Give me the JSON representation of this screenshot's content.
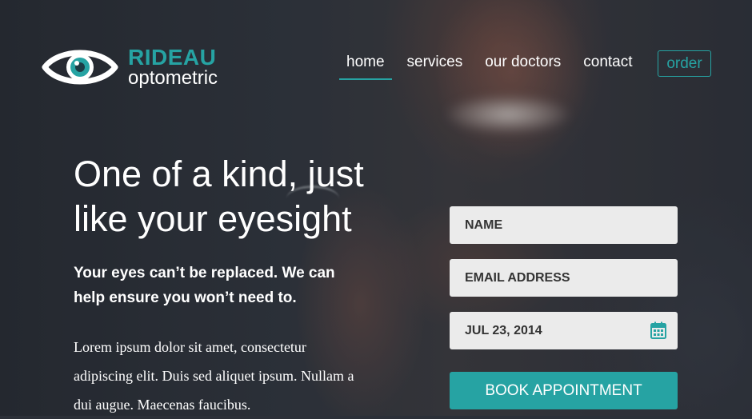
{
  "brand": {
    "name": "RIDEAU",
    "tagline": "optometric",
    "accent_color": "#26a3a3",
    "logo_icon": "eye-icon"
  },
  "nav": {
    "items": [
      {
        "label": "home",
        "active": true
      },
      {
        "label": "services",
        "active": false
      },
      {
        "label": "our doctors",
        "active": false
      },
      {
        "label": "contact",
        "active": false
      }
    ],
    "order_label": "order"
  },
  "hero": {
    "headline": "One of a kind, just like your eyesight",
    "subheadline": "Your eyes can’t be replaced. We can help ensure you won’t need to.",
    "body": "Lorem ipsum dolor sit amet, consectetur adipiscing elit. Duis sed aliquet ipsum. Nullam a dui augue. Maecenas faucibus."
  },
  "form": {
    "name_placeholder": "NAME",
    "email_placeholder": "EMAIL ADDRESS",
    "date_value": "JUL 23, 2014",
    "date_icon": "calendar-icon",
    "submit_label": "BOOK APPOINTMENT"
  }
}
